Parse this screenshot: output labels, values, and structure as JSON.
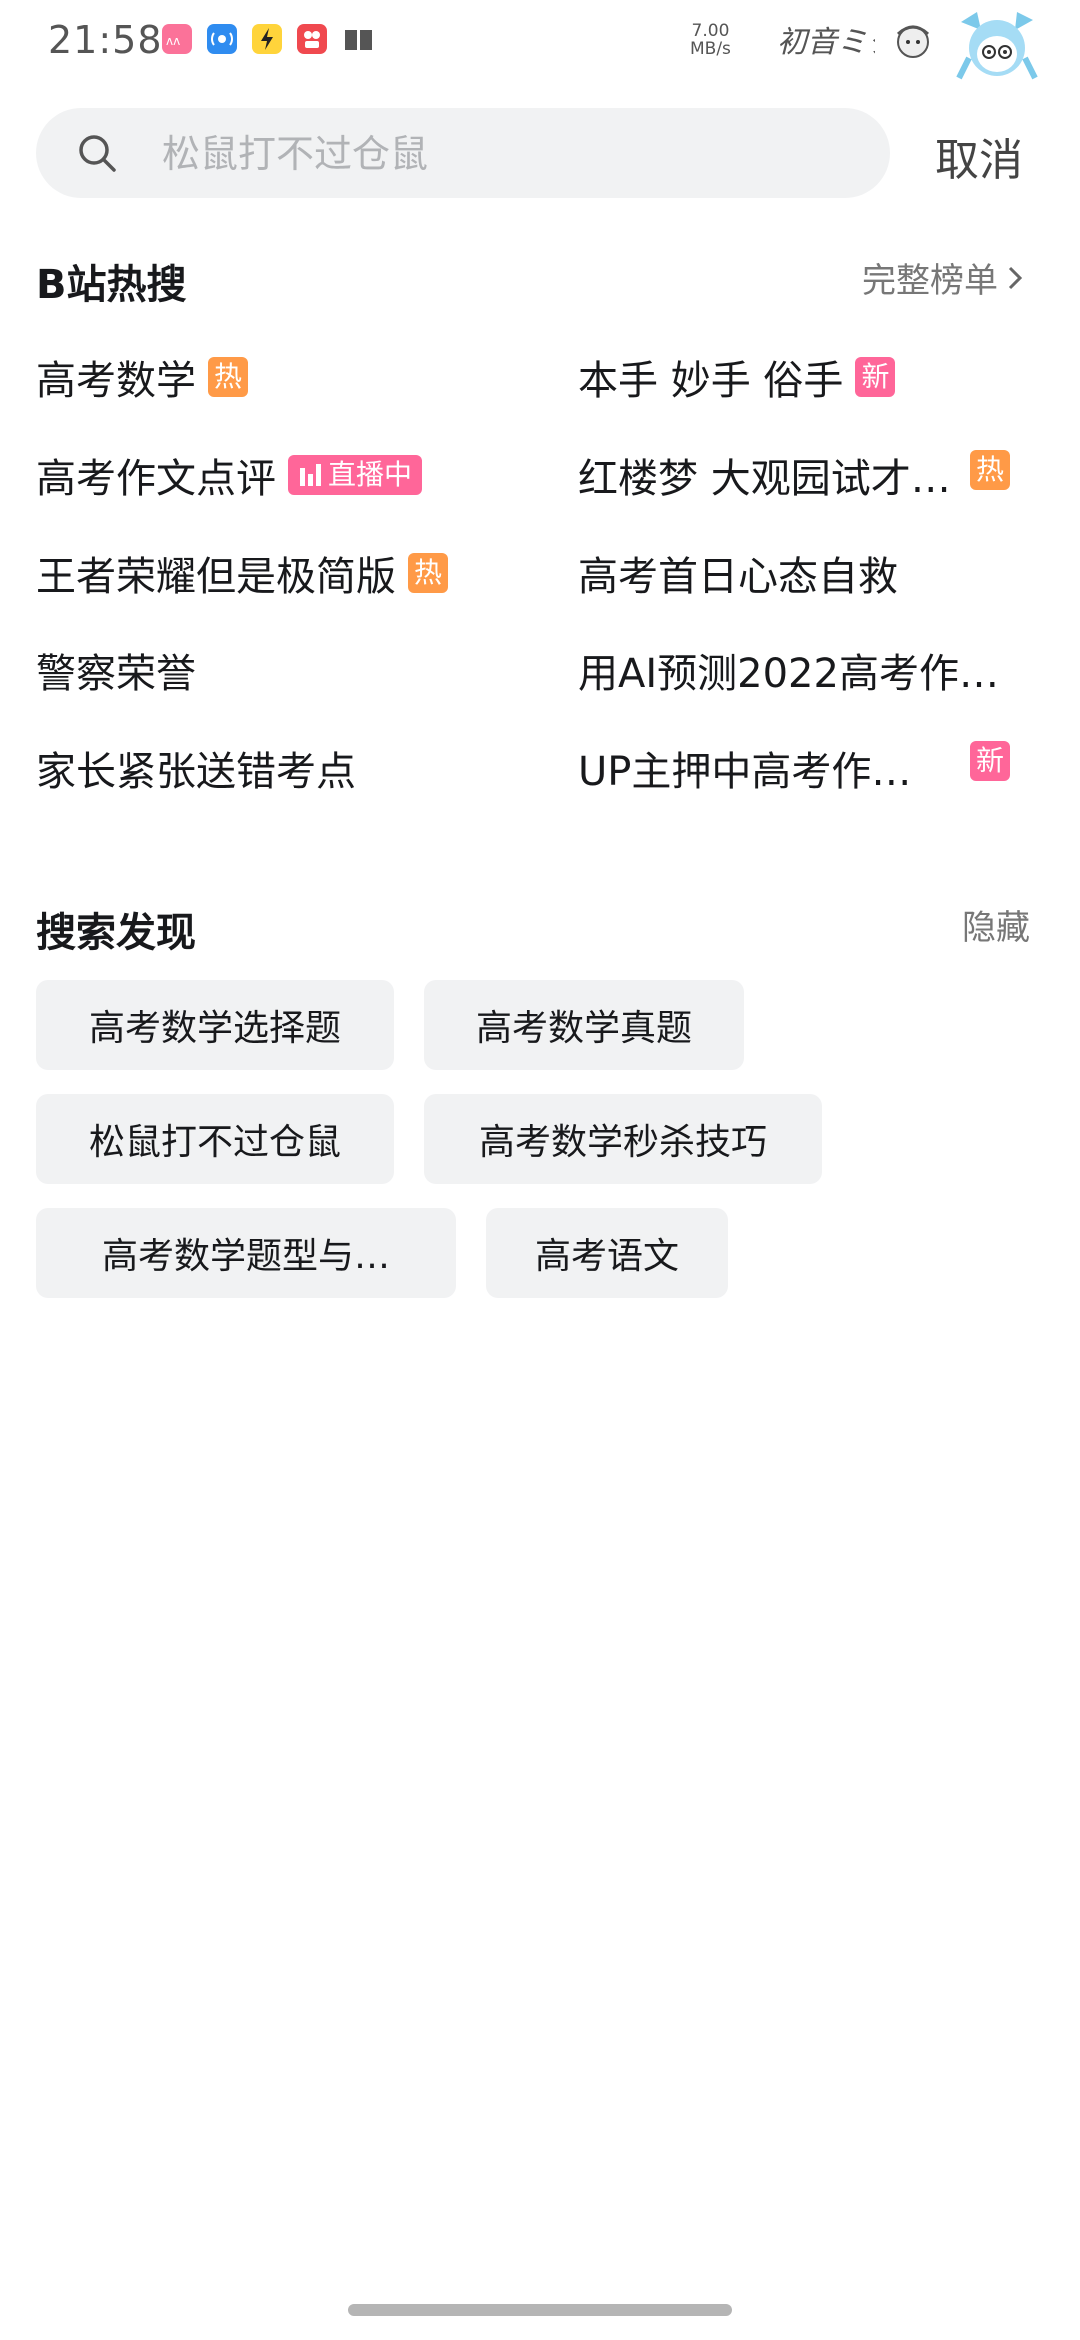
{
  "status_bar": {
    "time": "21:58",
    "speed_value": "7.00",
    "speed_unit": "MB/s",
    "icons": [
      "bilibili-app-icon",
      "wifi-share-icon",
      "flash-app-icon",
      "video-app-icon",
      "book-icon"
    ]
  },
  "search": {
    "placeholder": "松鼠打不过仓鼠",
    "cancel_label": "取消"
  },
  "hot_search": {
    "title": "B站热搜",
    "full_list_label": "完整榜单",
    "items": [
      {
        "text": "高考数学",
        "badge": "热"
      },
      {
        "text": "本手 妙手 俗手",
        "badge": "新"
      },
      {
        "text": "高考作文点评",
        "badge": "直播中"
      },
      {
        "text": "红楼梦 大观园试才…",
        "badge": "热"
      },
      {
        "text": "王者荣耀但是极简版",
        "badge": "热"
      },
      {
        "text": "高考首日心态自救",
        "badge": ""
      },
      {
        "text": "警察荣誉",
        "badge": ""
      },
      {
        "text": "用AI预测2022高考作…",
        "badge": ""
      },
      {
        "text": "家长紧张送错考点",
        "badge": ""
      },
      {
        "text": "UP主押中高考作…",
        "badge": "新"
      }
    ]
  },
  "discover": {
    "title": "搜索发现",
    "hide_label": "隐藏",
    "chips": [
      "高考数学选择题",
      "高考数学真题",
      "松鼠打不过仓鼠",
      "高考数学秒杀技巧",
      "高考数学题型与…",
      "高考语文"
    ]
  },
  "colors": {
    "hot_badge": "#ff9a47",
    "new_badge": "#ff6699",
    "chip_bg": "#f1f2f3"
  }
}
